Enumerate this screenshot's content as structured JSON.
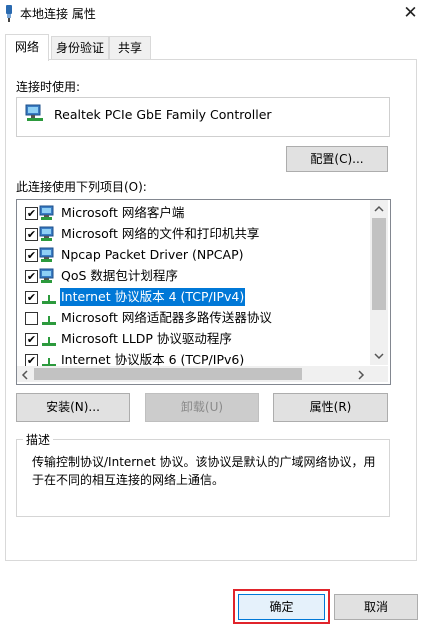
{
  "window": {
    "title": "本地连接 属性"
  },
  "tabs": [
    {
      "label": "网络"
    },
    {
      "label": "身份验证"
    },
    {
      "label": "共享"
    }
  ],
  "connect_using": {
    "label": "连接时使用:",
    "adapter": "Realtek PCIe GbE Family Controller",
    "configure_button": "配置(C)..."
  },
  "items_section": {
    "label": "此连接使用下列项目(O):",
    "items": [
      {
        "label": "Microsoft 网络客户端",
        "checked": true,
        "icon": "network-client-icon"
      },
      {
        "label": "Microsoft 网络的文件和打印机共享",
        "checked": true,
        "icon": "network-client-icon"
      },
      {
        "label": "Npcap Packet Driver (NPCAP)",
        "checked": true,
        "icon": "network-client-icon"
      },
      {
        "label": "QoS 数据包计划程序",
        "checked": true,
        "icon": "network-client-icon"
      },
      {
        "label": "Internet 协议版本 4 (TCP/IPv4)",
        "checked": true,
        "icon": "protocol-icon",
        "selected": true
      },
      {
        "label": "Microsoft 网络适配器多路传送器协议",
        "checked": false,
        "icon": "protocol-icon"
      },
      {
        "label": "Microsoft LLDP 协议驱动程序",
        "checked": true,
        "icon": "protocol-icon"
      },
      {
        "label": "Internet 协议版本 6 (TCP/IPv6)",
        "checked": true,
        "icon": "protocol-icon"
      }
    ]
  },
  "buttons": {
    "install": "安装(N)...",
    "uninstall": "卸载(U)",
    "properties": "属性(R)",
    "ok": "确定",
    "cancel": "取消"
  },
  "description": {
    "legend": "描述",
    "text": "传输控制协议/Internet 协议。该协议是默认的广域网络协议，用于在不同的相互连接的网络上通信。"
  },
  "colors": {
    "selection": "#0078d7",
    "highlight_border": "#e0242b",
    "focus_border": "#0078d7"
  }
}
